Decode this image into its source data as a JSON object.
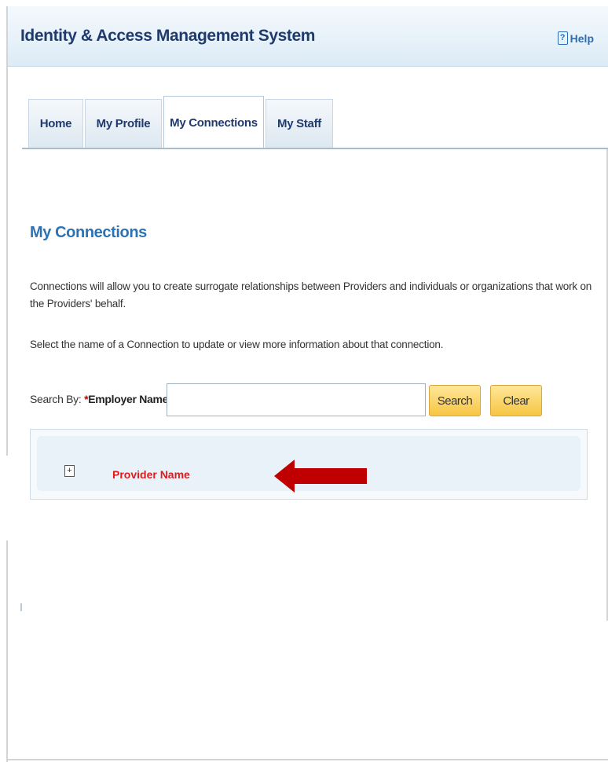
{
  "header": {
    "title": "Identity & Access Management System",
    "help_label": "Help",
    "help_icon": "question-icon"
  },
  "tabs": [
    {
      "label": "Home",
      "active": false
    },
    {
      "label": "My Profile",
      "active": false
    },
    {
      "label": "My Connections",
      "active": true
    },
    {
      "label": "My Staff",
      "active": false
    }
  ],
  "main": {
    "title": "My Connections",
    "description": "Connections will allow you to create surrogate relationships between Providers and individuals or organizations that work on the Providers' behalf.",
    "instruction": "Select the name of a Connection to update or view more information about that connection."
  },
  "search": {
    "label": "Search By:",
    "required_mark": "*",
    "field_label": "Employer Name",
    "value": "",
    "search_button": "Search",
    "clear_button": "Clear"
  },
  "results": {
    "items": [
      {
        "name": "Provider Name",
        "expand_icon": "plus-icon",
        "expand_symbol": "+"
      }
    ],
    "annotation": {
      "icon": "arrow-left-icon",
      "color": "#c00000"
    }
  },
  "colors": {
    "title_blue": "#1f3b6e",
    "link_blue": "#2b73b5",
    "button_yellow": "#f6c542",
    "provider_red": "#e01b1b"
  }
}
